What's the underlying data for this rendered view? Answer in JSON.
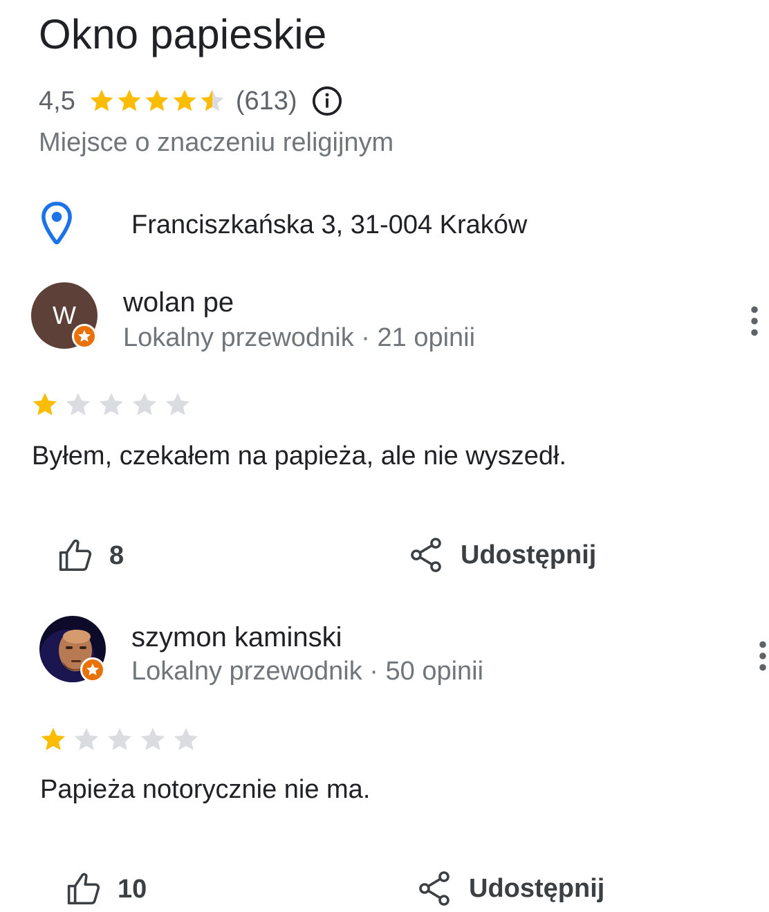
{
  "place": {
    "title": "Okno papieskie",
    "rating": "4,5",
    "rating_fraction": 0.9,
    "review_count": "(613)",
    "category": "Miejsce o znaczeniu religijnym",
    "address": "Franciszkańska 3, 31-004 Kraków"
  },
  "colors": {
    "star_gold": "#fbbc04",
    "star_empty": "#dadce0",
    "pin_blue": "#1a73e8",
    "badge_orange": "#e8710a"
  },
  "icons": {
    "rating_star": "star-icon",
    "info": "info-icon",
    "address": "location-pin-icon",
    "more": "more-vert-icon",
    "like": "thumb-up-icon",
    "share": "share-icon"
  },
  "reviews": [
    {
      "avatar_letter": "W",
      "name": "wolan pe",
      "meta": "Lokalny przewodnik · 21 opinii",
      "stars": 1,
      "stars_max": 5,
      "text": "Byłem, czekałem na papieża, ale nie wyszedł.",
      "likes": "8",
      "share_label": "Udostępnij"
    },
    {
      "avatar_letter": "",
      "name": "szymon kaminski",
      "meta": "Lokalny przewodnik · 50 opinii",
      "stars": 1,
      "stars_max": 5,
      "text": "Papieża notorycznie nie ma.",
      "likes": "10",
      "share_label": "Udostępnij"
    }
  ]
}
